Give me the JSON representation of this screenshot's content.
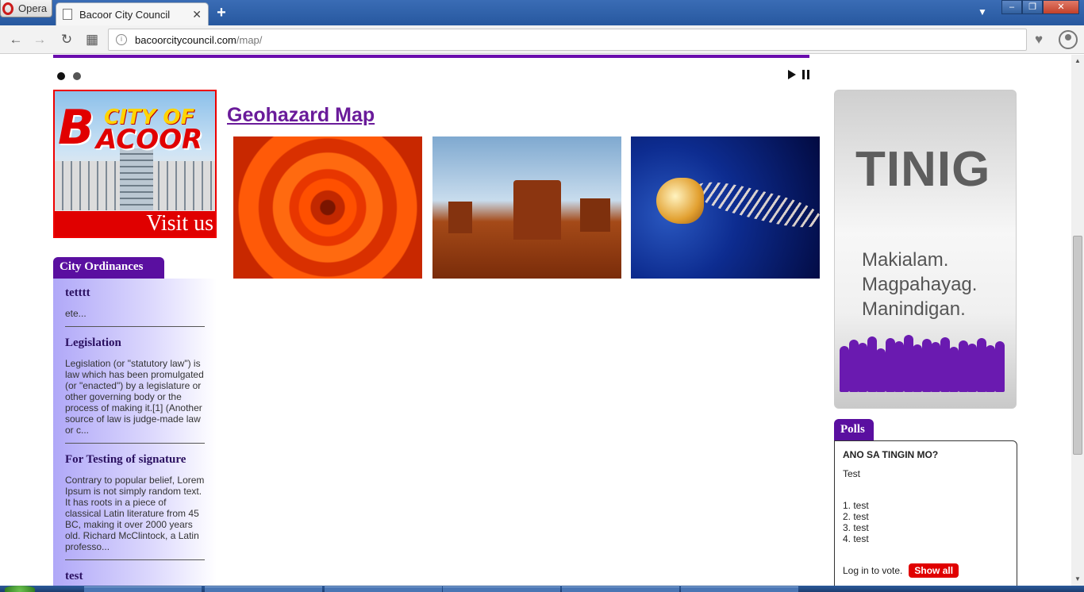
{
  "browser": {
    "app_name": "Opera",
    "tab_title": "Bacoor City Council",
    "url_host": "bacoorcitycouncil.com",
    "url_path": "/map/"
  },
  "slider": {
    "dots": 2,
    "active_dot": 0
  },
  "visit_banner": {
    "logo_letter": "B",
    "logo_line1": "CITY OF",
    "logo_line2": "ACOOR",
    "cta": "Visit us"
  },
  "ordinances": {
    "heading": "City Ordinances",
    "items": [
      {
        "title": "tetttt",
        "excerpt": "ete..."
      },
      {
        "title": "Legislation",
        "excerpt": "Legislation (or \"statutory law\") is law which has been promulgated (or \"enacted\") by a legislature or other governing body or the process of making it.[1] (Another source of law is judge-made law or c..."
      },
      {
        "title": "For Testing of signature",
        "excerpt": "Contrary to popular belief, Lorem Ipsum is not simply random text. It has roots in a piece of classical Latin literature from 45 BC, making it over 2000 years old. Richard McClintock, a Latin professo..."
      },
      {
        "title": "test",
        "excerpt": ""
      }
    ]
  },
  "main": {
    "page_link": "Geohazard Map",
    "gallery": [
      "chrysanthemum-photo",
      "desert-butte-photo",
      "jellyfish-photo"
    ]
  },
  "tinig": {
    "title": "TINIG",
    "line1": "Makialam.",
    "line2": "Magpahayag.",
    "line3": "Manindigan."
  },
  "polls": {
    "heading": "Polls",
    "question": "ANO SA TINGIN MO?",
    "description": "Test",
    "options": [
      "1. test",
      "2. test",
      "3. test",
      "4. test"
    ],
    "login_text": "Log in to vote.",
    "show_all": "Show all"
  },
  "colors": {
    "brand_purple": "#5a0fa0",
    "accent_red": "#e00000"
  }
}
